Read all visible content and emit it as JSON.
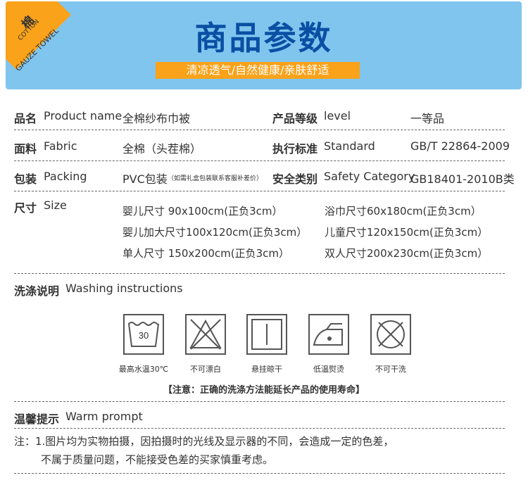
{
  "header": {
    "corner_cn": "棉",
    "corner_en1": "COTTON",
    "corner_en2": "GAUZE TOWEL",
    "title": "商品参数",
    "subtitle": "清凉透气/自然健康/亲肤舒适",
    "accent_color": "#f9a21a",
    "title_color": "#0a4fa3",
    "bg_color": "#7fc5ee"
  },
  "params": {
    "name_cn": "品名",
    "name_en": "Product name",
    "name_val": "全棉纱布巾被",
    "grade_cn": "产品等级",
    "grade_en": "level",
    "grade_val": "一等品",
    "fabric_cn": "面料",
    "fabric_en": "Fabric",
    "fabric_val": "全棉（头茬棉）",
    "std_cn": "执行标准",
    "std_en": "Standard",
    "std_val": "GB/T 22864-2009",
    "pack_cn": "包装",
    "pack_en": "Packing",
    "pack_val": "PVC包装",
    "pack_note": "（如需礼盒包装联系客服补差价）",
    "safety_cn": "安全类别",
    "safety_en": "Safety Category",
    "safety_val": "GB18401-2010B类",
    "size_cn": "尺寸",
    "size_en": "Size",
    "sizes": [
      "婴儿尺寸 90x100cm(正负3cm）",
      "浴巾尺寸60x180cm(正负3cm）",
      "婴儿加大尺寸100x120cm(正负3cm）",
      "儿童尺寸120x150cm(正负3cm）",
      "单人尺寸 150x200cm(正负3cm）",
      "双人尺寸200x230cm(正负3cm）"
    ]
  },
  "washing": {
    "title_cn": "洗涤说明",
    "title_en": "Washing instructions",
    "wash_temp": "30",
    "icons": [
      {
        "icon": "wash-30-icon",
        "label": "最高水温30℃"
      },
      {
        "icon": "no-bleach-icon",
        "label": "不可漂白"
      },
      {
        "icon": "hang-dry-icon",
        "label": "悬挂晾干"
      },
      {
        "icon": "low-iron-icon",
        "label": "低温熨烫"
      },
      {
        "icon": "no-dry-clean-icon",
        "label": "不可干洗"
      }
    ],
    "note": "【注意：正确的洗涤方法能延长产品的使用寿命】"
  },
  "prompt": {
    "title_cn": "温馨提示",
    "title_en": "Warm prompt",
    "line1": "注：1.图片均为实物拍摄，因拍摄时的光线及显示器的不同，会造成一定的色差，",
    "line2": "不属于质量问题，不能接受色差的买家慎重考虑。"
  }
}
